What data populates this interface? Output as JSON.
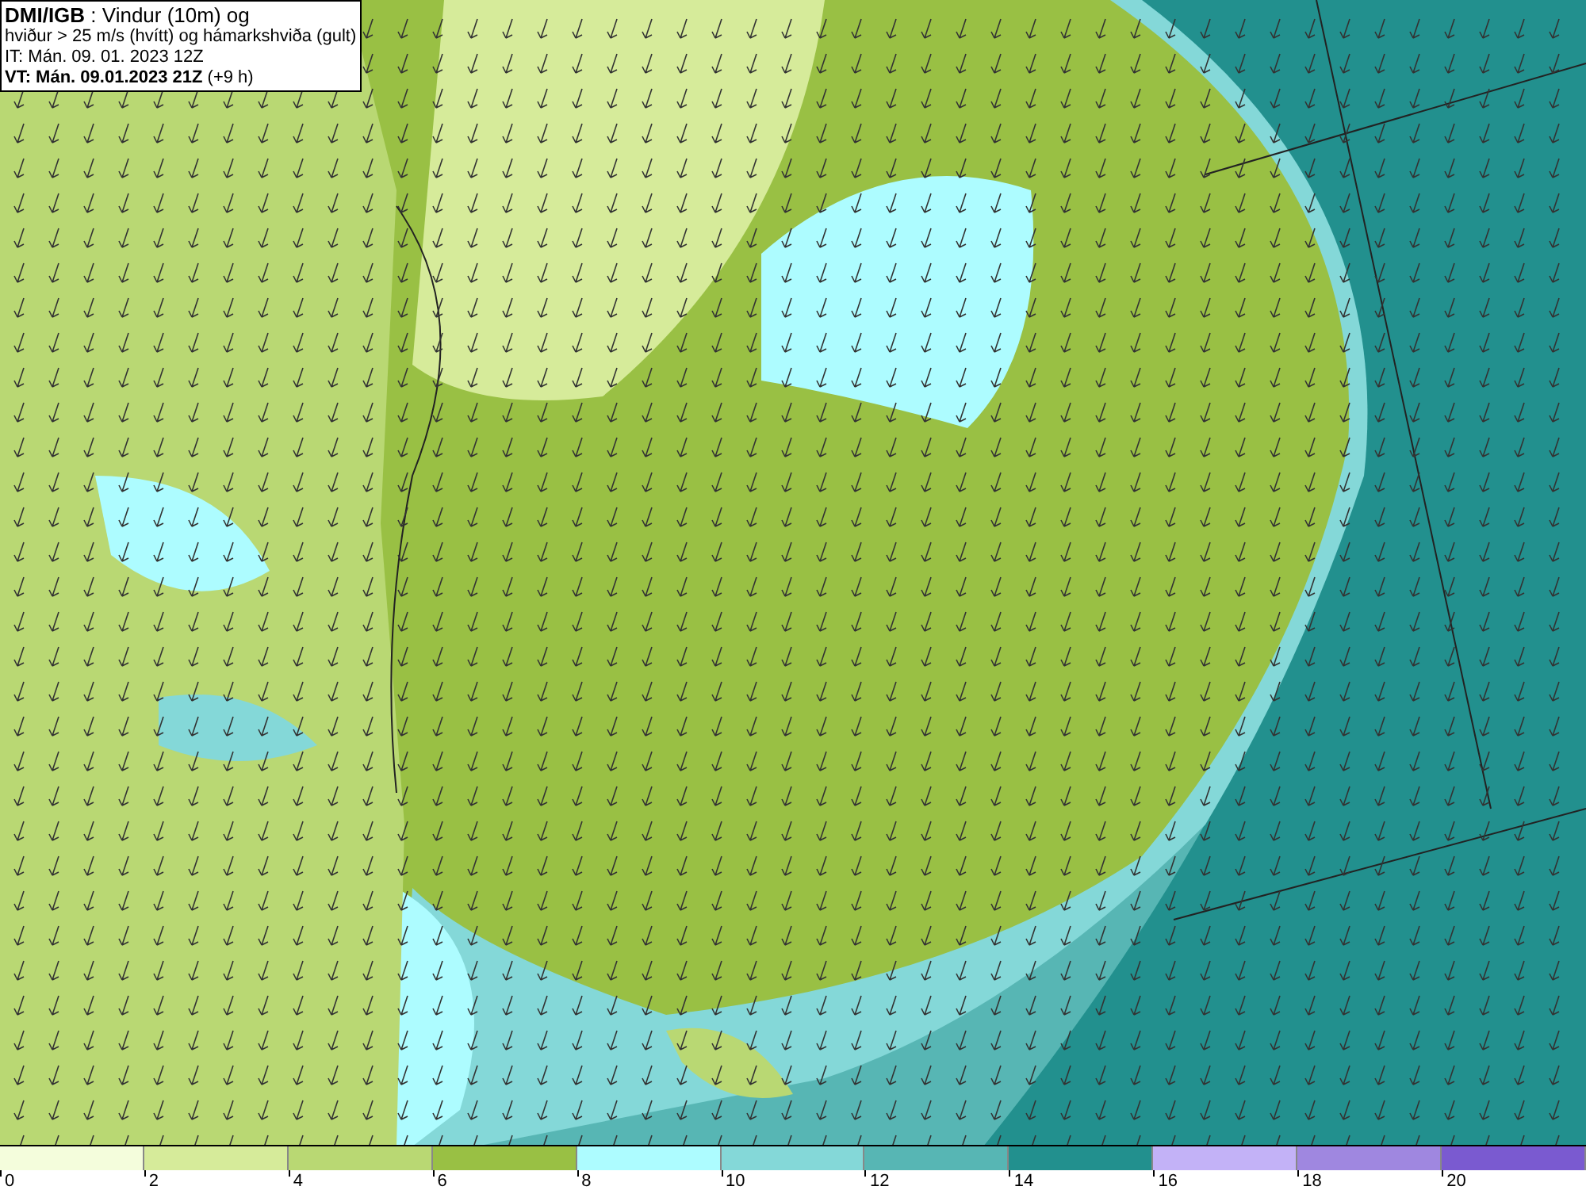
{
  "title_box": {
    "lines": [
      "**DMI/IGB** : Vindur (10m) og",
      "hviður > 25 m/s (hvítt) og hámarkshviða (gult)",
      "IT: Mán. 09. 01. 2023 12Z",
      "**VT: Mán. 09.01.2023 21Z** (+9 h)"
    ]
  },
  "legend": [
    {
      "label": "0",
      "color": "#f4fddc"
    },
    {
      "label": "2",
      "color": "#d6eb9a"
    },
    {
      "label": "4",
      "color": "#b9d873"
    },
    {
      "label": "6",
      "color": "#99c044"
    },
    {
      "label": "8",
      "color": "#adfcff"
    },
    {
      "label": "10",
      "color": "#84d8d8"
    },
    {
      "label": "12",
      "color": "#57b6b4"
    },
    {
      "label": "14",
      "color": "#22908e"
    },
    {
      "label": "16",
      "color": "#c3b2f7"
    },
    {
      "label": "18",
      "color": "#9f87e0"
    },
    {
      "label": "20",
      "color": "#7a5ad0"
    }
  ]
}
